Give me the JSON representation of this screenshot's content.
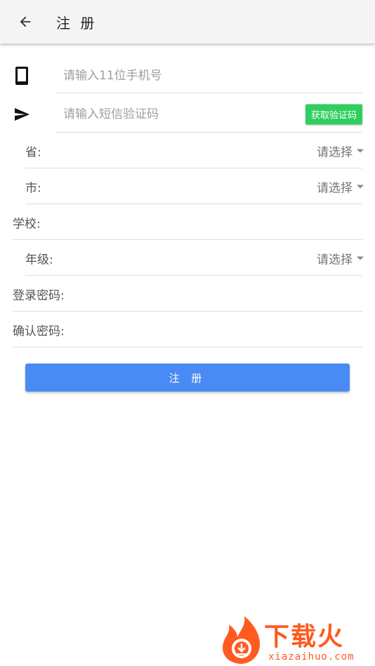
{
  "appbar": {
    "title": "注 册",
    "back_icon": "arrow-back-icon"
  },
  "form": {
    "phone": {
      "placeholder": "请输入11位手机号",
      "icon": "phone-icon"
    },
    "sms": {
      "placeholder": "请输入短信验证码",
      "icon": "send-icon",
      "button_label": "获取验证码",
      "button_color": "#2fce5f"
    },
    "province": {
      "label": "省:",
      "select": "请选择"
    },
    "city": {
      "label": "市:",
      "select": "请选择"
    },
    "school": {
      "label": "学校:",
      "value": ""
    },
    "grade": {
      "label": "年级:",
      "select": "请选择"
    },
    "password": {
      "label": "登录密码:",
      "value": ""
    },
    "confirm_password": {
      "label": "确认密码:",
      "value": ""
    }
  },
  "submit": {
    "label": "注 册",
    "color": "#4a8af4"
  },
  "watermark": {
    "brand": "下载火",
    "url": "xiazaihuo.com",
    "color": "#ff5a1f"
  }
}
